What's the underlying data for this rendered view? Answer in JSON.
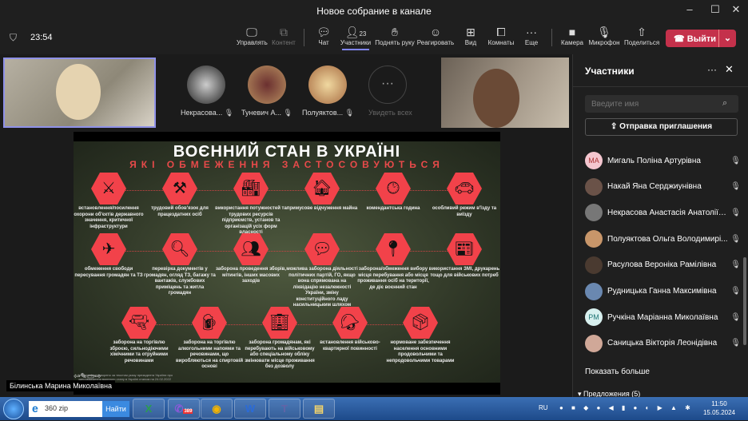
{
  "window": {
    "title": "Новое собрание в канале",
    "minimize": "–",
    "maximize": "☐",
    "close": "✕"
  },
  "toolbar": {
    "timer": "23:54",
    "manage": "Управлять",
    "content": "Контент",
    "chat": "Чат",
    "participants": "Участники",
    "participants_count": "23",
    "raise_hand": "Поднять руку",
    "react": "Реагировать",
    "view": "Вид",
    "rooms": "Комнаты",
    "more": "Еще",
    "camera": "Камера",
    "mic": "Микрофон",
    "share": "Поделиться",
    "leave": "Выйти"
  },
  "gallery": {
    "people": [
      {
        "name": "Некрасова..."
      },
      {
        "name": "Туневич А..."
      },
      {
        "name": "Полуяктов..."
      }
    ],
    "see_all": "Увидеть всех"
  },
  "presenter": "Білинська Марина Миколаївна",
  "slide": {
    "title": "ВОЄННИЙ СТАН В УКРАЇНІ",
    "subtitle": "ЯКІ ОБМЕЖЕННЯ ЗАСТОСОВУЮТЬСЯ",
    "items": [
      "встановлення/посилення охорони об'єктів державного значення, критичної інфраструктури",
      "трудовий обов'язок для працездатних осіб",
      "використання потужностей та трудових ресурсів підприємств, установ та організацій усіх форм власності",
      "примусове відчуження майна",
      "комендантська година",
      "особливий режим в'їзду та виїзду",
      "обмеження свободи пересування громадян та ТЗ",
      "перевірка документів у громадян, огляд ТЗ, багажу та вантажів, службових приміщень та житла громадян",
      "заборона проведення зборів, мітингів, інших масових заходів",
      "можлива заборона діяльності політичних партій, ГО, якщо вона спрямована на ліквідацію незалежності України, зміну конституційного ладу насильницьким шляхом",
      "заборона/обмеження вибору місця перебування або місця проживання осіб на території, де діє воєнний стан",
      "використання ЗМІ, друкарень тощо для військових потреб",
      "заборона на торгівлю зброєю, сильнодіючими хімічними та отруйними речовинами",
      "заборона на торгівлю алкогольними напоями та речовинами, що виробляються на спиртовій основі",
      "заборона громадянам, які перебувають на військовому або спеціальному обліку змінювати місце проживання без дозволу",
      "встановлення військово-квартирної повинності",
      "нормоване забезпечення населення основними продовольчими та непродовольчими товарами"
    ],
    "note": "Інфографіку створено за текстом указу президента України про запровадження воєнного стану в Україні станом на 24.02.2022 року"
  },
  "panel": {
    "title": "Участники",
    "search_placeholder": "Введите имя",
    "invite": "Отправка приглашения",
    "members": [
      {
        "initials": "МА",
        "name": "Мигаль Поліна Артурівна"
      },
      {
        "initials": "",
        "name": "Накай Яна Серджиунівна"
      },
      {
        "initials": "",
        "name": "Некрасова Анастасія Анатоліївна"
      },
      {
        "initials": "",
        "name": "Полуяктова Ольга Володимирі..."
      },
      {
        "initials": "",
        "name": "Расулова Вероніка Рамілівна"
      },
      {
        "initials": "",
        "name": "Рудницька Ганна Максимівна"
      },
      {
        "initials": "РМ",
        "name": "Ручкіна Маріанна Миколаївна"
      },
      {
        "initials": "",
        "name": "Саницька Вікторія Леонідівна"
      }
    ],
    "show_more": "Показать больше",
    "suggestions": "Предложения (5)"
  },
  "taskbar": {
    "search_value": "360 zip",
    "find": "Найти",
    "lang": "RU",
    "time": "11:50",
    "date": "15.05.2024",
    "viber_badge": "389"
  }
}
